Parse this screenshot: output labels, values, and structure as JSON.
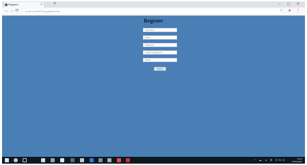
{
  "browser": {
    "tab_title": "Register",
    "tab_close": "×",
    "new_tab": "+",
    "window_controls": "– ▢ ✕",
    "nav_icons": "←  →  ⟳",
    "address": "localhost:5000/register/index",
    "toolbar_right": "☆ ● ⋮"
  },
  "page": {
    "title": "Register",
    "fields": [
      {
        "placeholder": "Username"
      },
      {
        "placeholder": "Email"
      },
      {
        "placeholder": "Password"
      },
      {
        "placeholder": "Confirm Password"
      },
      {
        "placeholder": "Phone"
      }
    ],
    "submit_label": "Submit",
    "background_color": "#4a7fb5"
  },
  "taskbar": {
    "icons": [
      "search-icon",
      "task-view-icon",
      "explorer-icon",
      "store-icon",
      "chrome-icon",
      "app-icon",
      "app-icon",
      "app-icon",
      "app-icon",
      "app-icon",
      "office-icon"
    ],
    "tray_text": "^ ☁ ◂ ✉ ENG",
    "time": "10:45",
    "date": "15/04/2019"
  }
}
